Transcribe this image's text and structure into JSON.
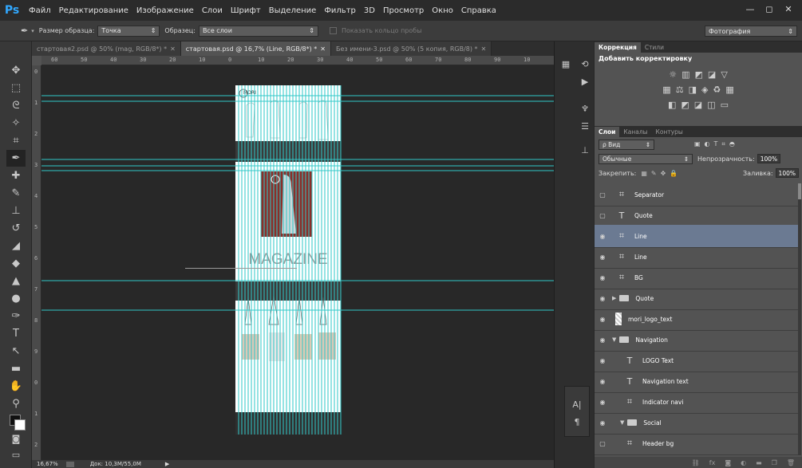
{
  "app": {
    "logo": "Ps",
    "menu": [
      "Файл",
      "Редактирование",
      "Изображение",
      "Слои",
      "Шрифт",
      "Выделение",
      "Фильтр",
      "3D",
      "Просмотр",
      "Окно",
      "Справка"
    ],
    "window_buttons": [
      "—",
      "◻",
      "✕"
    ]
  },
  "options": {
    "sample_size_label": "Размер образца:",
    "sample_size_value": "Точка",
    "sample_label": "Образец:",
    "sample_value": "Все слои",
    "show_ring_label": "Показать кольцо пробы",
    "workspace": "Фотография"
  },
  "tabs": [
    {
      "label": "стартовая2.psd @ 50% (mag, RGB/8*) *",
      "close": "✕",
      "active": false
    },
    {
      "label": "стартовая.psd @ 16,7% (Line, RGB/8*) *",
      "close": "✕",
      "active": true
    },
    {
      "label": "Без имени-3.psd @ 50% (5 копия, RGB/8) *",
      "close": "✕",
      "active": false
    }
  ],
  "ruler_h": [
    "60",
    "50",
    "40",
    "30",
    "20",
    "10",
    "0",
    "10",
    "20",
    "30",
    "40",
    "50",
    "60",
    "70",
    "80",
    "90",
    "10"
  ],
  "ruler_v": [
    "0",
    "1",
    "2",
    "3",
    "4",
    "5",
    "6",
    "7",
    "8",
    "9",
    "0",
    "1",
    "2"
  ],
  "document": {
    "logo": "MORI",
    "headline": "MAGAZINE"
  },
  "status": {
    "zoom": "16,67%",
    "doc": "Док: 10,3M/55,0M",
    "arrow": "▶"
  },
  "adjustments": {
    "tabs": [
      "Коррекция",
      "Стили"
    ],
    "title": "Добавить корректировку",
    "row1": [
      "☼",
      "▥",
      "◩",
      "◪",
      "▽"
    ],
    "row2": [
      "▦",
      "⚖",
      "◨",
      "◈",
      "♻",
      "▦"
    ],
    "row3": [
      "◧",
      "◩",
      "◪",
      "◫",
      "▭"
    ]
  },
  "layers_panel": {
    "tabs": [
      "Слои",
      "Каналы",
      "Контуры"
    ],
    "filter_label": "ρ Вид",
    "blend_mode": "Обычные",
    "opacity_label": "Непрозрачность:",
    "opacity_value": "100%",
    "lock_label": "Закрепить:",
    "fill_label": "Заливка:",
    "fill_value": "100%",
    "layers": [
      {
        "name": "Separator",
        "kind": "smart",
        "visible": false,
        "selected": false,
        "indent": 0
      },
      {
        "name": "Quote",
        "kind": "text",
        "visible": false,
        "selected": false,
        "indent": 0
      },
      {
        "name": "Line",
        "kind": "smart",
        "visible": true,
        "selected": true,
        "indent": 0
      },
      {
        "name": "Line",
        "kind": "smart",
        "visible": true,
        "selected": false,
        "indent": 0
      },
      {
        "name": "BG",
        "kind": "smart",
        "visible": true,
        "selected": false,
        "indent": 0
      },
      {
        "name": "Quote",
        "kind": "folder-closed",
        "visible": true,
        "selected": false,
        "indent": 0
      },
      {
        "name": "mori_logo_text",
        "kind": "raster",
        "visible": true,
        "selected": false,
        "indent": 0
      },
      {
        "name": "Navigation",
        "kind": "folder-open",
        "visible": true,
        "selected": false,
        "indent": 0
      },
      {
        "name": "LOGO Text",
        "kind": "text",
        "visible": true,
        "selected": false,
        "indent": 1
      },
      {
        "name": "Navigation text",
        "kind": "text",
        "visible": true,
        "selected": false,
        "indent": 1
      },
      {
        "name": "Indicator navi",
        "kind": "smart",
        "visible": true,
        "selected": false,
        "indent": 1
      },
      {
        "name": "Social",
        "kind": "folder-open",
        "visible": true,
        "selected": false,
        "indent": 1
      },
      {
        "name": "Header bg",
        "kind": "smart",
        "visible": false,
        "selected": false,
        "indent": 1
      }
    ]
  },
  "colors": {
    "guide": "#31c8c8",
    "selection": "#6b7a92",
    "accent_blue": "#31a8ff"
  }
}
